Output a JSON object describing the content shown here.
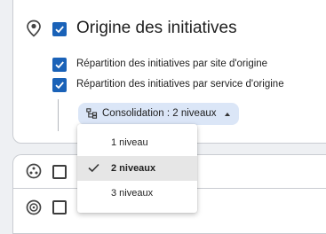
{
  "section_main": {
    "title": "Origine des initiatives",
    "icon": "location-pin-icon",
    "checked": true,
    "options": [
      {
        "label": "Répartition des initiatives par site d'origine",
        "checked": true
      },
      {
        "label": "Répartition des initiatives par service d'origine",
        "checked": true
      }
    ],
    "consolidation_chip": {
      "label": "Consolidation : 2 niveaux",
      "icon": "hierarchy-icon"
    }
  },
  "dropdown": {
    "items": [
      {
        "label": "1 niveau",
        "selected": false
      },
      {
        "label": "2 niveaux",
        "selected": true
      },
      {
        "label": "3 niveaux",
        "selected": false
      }
    ]
  },
  "section_2": {
    "icon": "dots-circle-icon",
    "checked": false
  },
  "section_3": {
    "icon": "target-icon",
    "checked": false
  },
  "colors": {
    "accent": "#1a62b8",
    "chip_background": "#dbe6f7",
    "selected_item_background": "#e6e6e6"
  }
}
